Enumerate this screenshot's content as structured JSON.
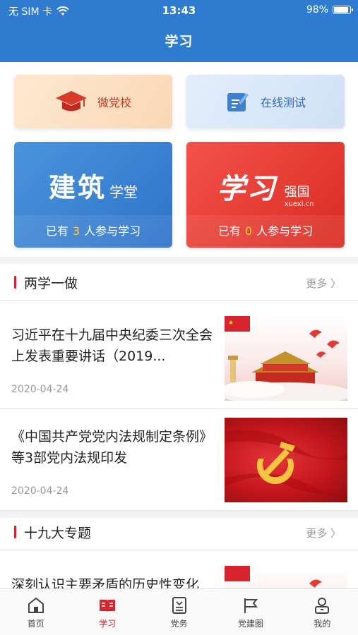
{
  "status_bar": {
    "carrier": "无 SIM 卡",
    "time": "13:43",
    "battery": "98%"
  },
  "nav": {
    "title": "学习"
  },
  "quick_cards": [
    {
      "label": "微党校",
      "icon": "graduation-cap-icon"
    },
    {
      "label": "在线测试",
      "icon": "edit-test-icon"
    }
  ],
  "feature_cards": [
    {
      "brand_big": "建筑",
      "brand_small": "学堂",
      "count_prefix": "已有",
      "count": "3",
      "count_suffix": "人参与学习"
    },
    {
      "brand_script": "学习",
      "brand_side": "强国",
      "brand_url": "xuexi.cn",
      "count_prefix": "已有",
      "count": "0",
      "count_suffix": "人参与学习"
    }
  ],
  "sections": [
    {
      "title": "两学一做",
      "more": "更多 〉"
    },
    {
      "title": "十九大专题",
      "more": "更多 〉"
    }
  ],
  "news": [
    {
      "headline": "习近平在十九届中央纪委三次全会上发表重要讲话（2019...",
      "date": "2020-04-24"
    },
    {
      "headline": "《中国共产党党内法规制定条例》等3部党内法规印发",
      "date": "2020-04-24"
    },
    {
      "headline": "深刻认识主要矛盾的历史性变化",
      "date": ""
    }
  ],
  "tabbar": {
    "items": [
      {
        "label": "首页",
        "icon": "home-icon",
        "active": false
      },
      {
        "label": "学习",
        "icon": "book-icon",
        "active": true
      },
      {
        "label": "党务",
        "icon": "document-icon",
        "active": false
      },
      {
        "label": "党建圈",
        "icon": "flag-icon",
        "active": false
      },
      {
        "label": "我的",
        "icon": "person-icon",
        "active": false
      }
    ]
  },
  "colors": {
    "primary": "#2e7bd0",
    "accent_red": "#d8242c",
    "highlight_yellow": "#ffd43b"
  }
}
